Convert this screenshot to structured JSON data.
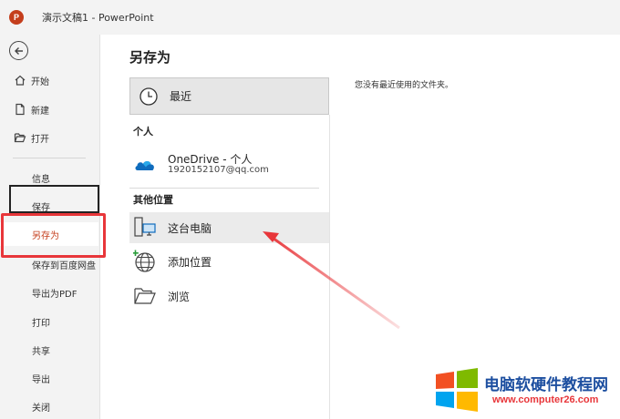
{
  "window": {
    "title": "演示文稿1 - PowerPoint",
    "app_badge": "P"
  },
  "nav": {
    "home": "开始",
    "new": "新建",
    "open": "打开",
    "info": "信息",
    "save": "保存",
    "save_as": "另存为",
    "save_baidu": "保存到百度网盘",
    "export_pdf": "导出为PDF",
    "print": "打印",
    "share": "共享",
    "export": "导出",
    "close": "关闭"
  },
  "main": {
    "title": "另存为",
    "recent": "最近",
    "personal_header": "个人",
    "onedrive_label": "OneDrive - 个人",
    "onedrive_account": "1920152107@qq.com",
    "other_header": "其他位置",
    "this_pc": "这台电脑",
    "add_place": "添加位置",
    "browse": "浏览"
  },
  "right": {
    "empty_message": "您没有最近使用的文件夹。"
  },
  "watermark": {
    "title": "电脑软硬件教程网",
    "url": "www.computer26.com"
  },
  "colors": {
    "accent": "#c43e1c",
    "highlight_red": "#e8363a",
    "selected_nav": "#ffffff"
  }
}
